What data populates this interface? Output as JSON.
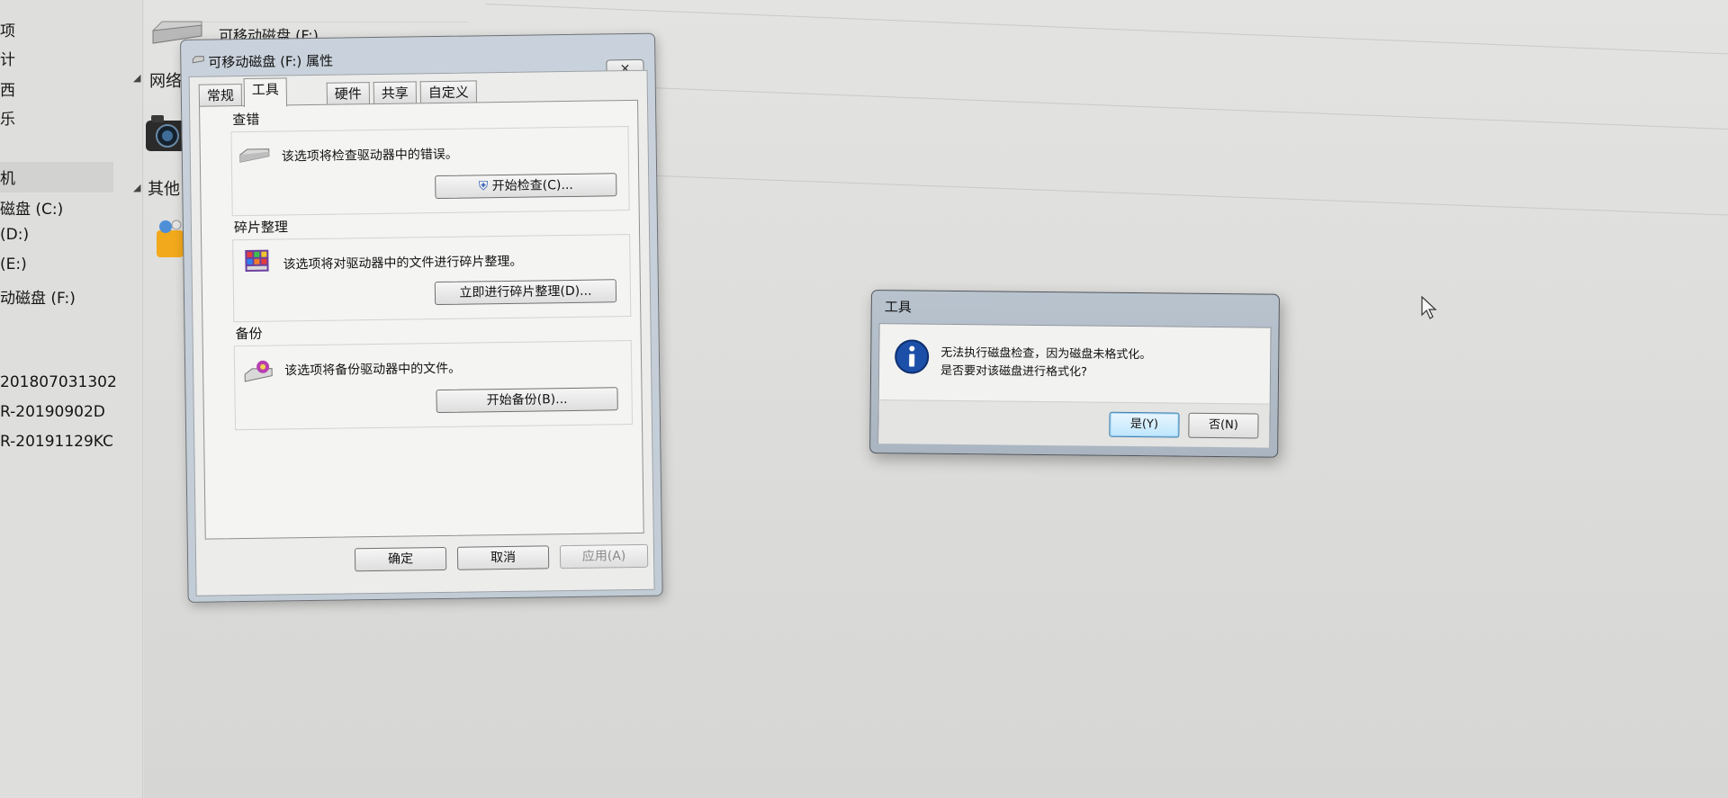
{
  "explorer": {
    "left_nav": {
      "partial_labels": [
        "项",
        "计",
        "西",
        "乐"
      ],
      "computer_partial": "机",
      "drives": [
        "磁盘 (C:)",
        "(D:)",
        "(E:)",
        "动磁盘 (F:)"
      ],
      "network_items": [
        "201807031302",
        "R-20190902D",
        "R-20191129KC"
      ]
    },
    "content": {
      "drive_name": "可移动磁盘 (F:)",
      "section_network": "网络",
      "section_other": "其他"
    }
  },
  "properties_dialog": {
    "title": "可移动磁盘 (F:) 属性",
    "close_glyph": "✕",
    "tabs": [
      {
        "label": "常规",
        "active": false
      },
      {
        "label": "工具",
        "active": true
      },
      {
        "label": "硬件",
        "active": false
      },
      {
        "label": "共享",
        "active": false
      },
      {
        "label": "自定义",
        "active": false
      }
    ],
    "groups": {
      "error_check": {
        "label": "查错",
        "text": "该选项将检查驱动器中的错误。",
        "button": "开始检查(C)...",
        "icon": "drive-check-icon"
      },
      "defrag": {
        "label": "碎片整理",
        "text": "该选项将对驱动器中的文件进行碎片整理。",
        "button": "立即进行碎片整理(D)...",
        "icon": "defrag-icon"
      },
      "backup": {
        "label": "备份",
        "text": "该选项将备份驱动器中的文件。",
        "button": "开始备份(B)...",
        "icon": "backup-icon"
      }
    },
    "buttons": {
      "ok": "确定",
      "cancel": "取消",
      "apply": "应用(A)"
    }
  },
  "message_box": {
    "title": "工具",
    "line1": "无法执行磁盘检查，因为磁盘未格式化。",
    "line2": "是否要对该磁盘进行格式化?",
    "yes": "是(Y)",
    "no": "否(N)",
    "icon": "information-icon"
  },
  "colors": {
    "dialog_frame": "#c2ccd6",
    "msg_frame": "#aab5c1",
    "info_blue": "#1c4fa8",
    "default_button": "#bee6fd"
  }
}
